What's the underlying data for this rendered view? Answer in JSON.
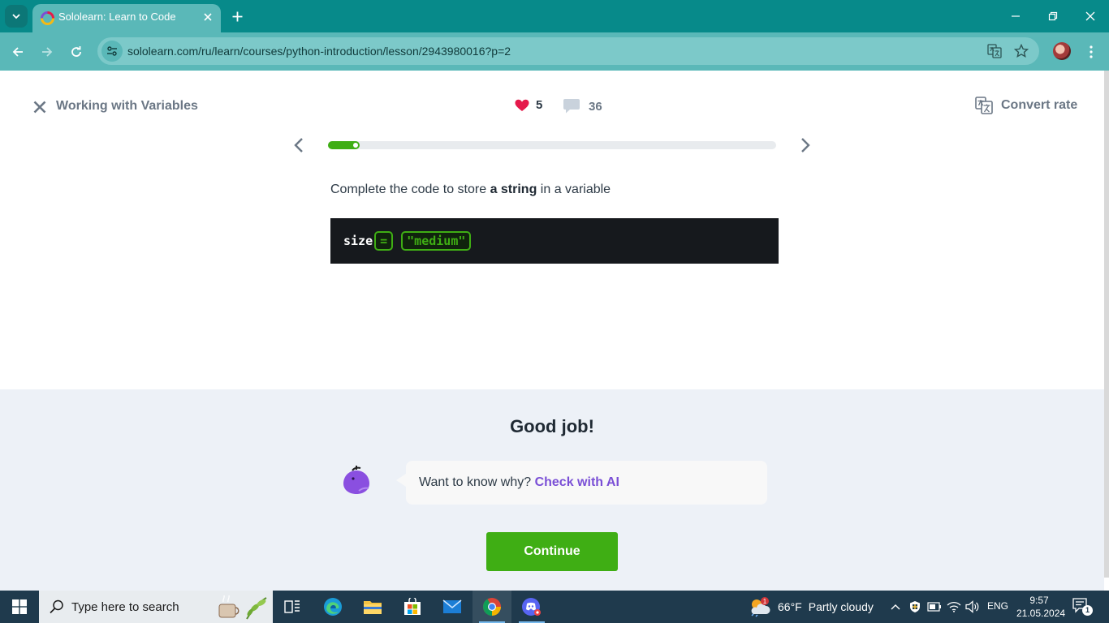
{
  "browser": {
    "tab_title": "Sololearn: Learn to Code",
    "url": "sololearn.com/ru/learn/courses/python-introduction/lesson/2943980016?p=2"
  },
  "lesson": {
    "title": "Working with Variables",
    "hearts": "5",
    "comments": "36",
    "convert_label": "Convert rate",
    "progress_fraction": 0.07
  },
  "exercise": {
    "instruction_pre": "Complete the code to store ",
    "instruction_bold": "a string",
    "instruction_post": " in a variable",
    "code_var": "size",
    "code_operator": "=",
    "code_value": "\"medium\""
  },
  "result": {
    "heading": "Good job!",
    "bubble_text": "Want to know why? ",
    "bubble_link": "Check with AI",
    "continue_label": "Continue"
  },
  "taskbar": {
    "search_placeholder": "Type here to search",
    "weather_temp": "66°F",
    "weather_desc": "Partly cloudy",
    "weather_badge": "1",
    "language": "ENG",
    "time": "9:57",
    "date": "21.05.2024",
    "notification_count": "1"
  },
  "colors": {
    "browser_frame": "#078a8a",
    "accent_green": "#3fae14",
    "link_purple": "#7a4fd6",
    "heart_red": "#e5194b",
    "taskbar": "#1f3a4d"
  }
}
